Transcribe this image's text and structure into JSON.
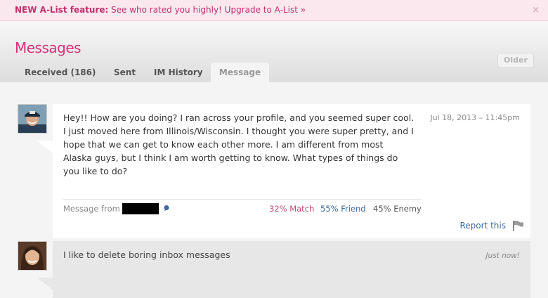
{
  "banner": {
    "lead": "NEW A-List feature:",
    "link": "See who rated you highly! Upgrade to A-List »",
    "close_icon": "×"
  },
  "header": {
    "title": "Messages",
    "older_button": "Older"
  },
  "tabs": [
    {
      "label": "Received (186)"
    },
    {
      "label": "Sent"
    },
    {
      "label": "IM History"
    },
    {
      "label": "Message",
      "active": true
    }
  ],
  "message": {
    "text": "Hey!! How are you doing? I ran across your profile, and you seemed super cool. I just moved here from Illinois/Wisconsin. I thought you were super pretty, and I hope that we can get to know each other more. I am different from most Alaska guys, but I think I am worth getting to know. What types of things do you like to do?",
    "timestamp": "Jul 18, 2013 – 11:45pm",
    "from_label": "Message from",
    "match": "32% Match",
    "friend": "55% Friend",
    "enemy": "45% Enemy",
    "report": "Report this"
  },
  "reply": {
    "text": "I like to delete boring inbox messages",
    "timestamp": "Just now!"
  },
  "colors": {
    "brand": "#d6337a",
    "link_blue": "#3d6a9c",
    "match_red": "#c24a6e"
  }
}
